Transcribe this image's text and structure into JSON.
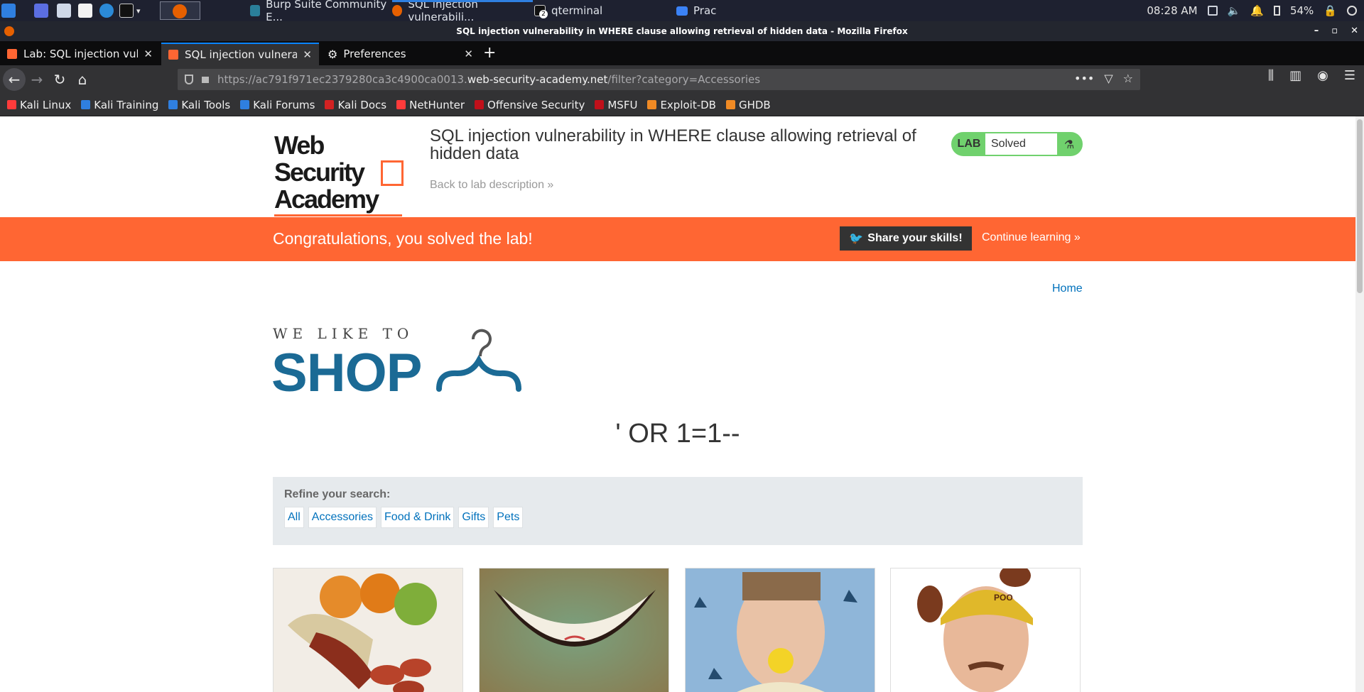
{
  "taskbar": {
    "windows": [
      {
        "label": "Burp Suite Community E..."
      },
      {
        "label": "SQL injection vulnerabili..."
      },
      {
        "label": "qterminal"
      },
      {
        "label": "Prac"
      }
    ],
    "badge": "2",
    "time": "08:28 AM",
    "battery": "54%"
  },
  "window": {
    "title": "SQL injection vulnerability in WHERE clause allowing retrieval of hidden data - Mozilla Firefox"
  },
  "tabs": [
    {
      "label": "Lab: SQL injection vulnera"
    },
    {
      "label": "SQL injection vulnerabilit"
    },
    {
      "label": "Preferences"
    }
  ],
  "urlbar": {
    "prefix": "https://ac791f971ec2379280ca3c4900ca0013.",
    "host": "web-security-academy.net",
    "path": "/filter?category=Accessories"
  },
  "bookmarks": [
    {
      "label": "Kali Linux",
      "color": "#ff3b3b"
    },
    {
      "label": "Kali Training",
      "color": "#2f7fe0"
    },
    {
      "label": "Kali Tools",
      "color": "#2f7fe0"
    },
    {
      "label": "Kali Forums",
      "color": "#2f7fe0"
    },
    {
      "label": "Kali Docs",
      "color": "#d22222"
    },
    {
      "label": "NetHunter",
      "color": "#ff3b3b"
    },
    {
      "label": "Offensive Security",
      "color": "#c0101a"
    },
    {
      "label": "MSFU",
      "color": "#c0101a"
    },
    {
      "label": "Exploit-DB",
      "color": "#f08a24"
    },
    {
      "label": "GHDB",
      "color": "#f08a24"
    }
  ],
  "header": {
    "logo_line1": "Web Security",
    "logo_line2": "Academy",
    "lab_title": "SQL injection vulnerability in WHERE clause allowing retrieval of hidden data",
    "back_link": "Back to lab description »",
    "status_tag": "LAB",
    "status_value": "Solved"
  },
  "banner": {
    "message": "Congratulations, you solved the lab!",
    "share_label": "Share your skills!",
    "continue_label": "Continue learning »",
    "color": "#ff6633"
  },
  "nav": {
    "home": "Home"
  },
  "hero": {
    "small": "WE LIKE TO",
    "big": "SHOP"
  },
  "search_term": "' OR 1=1--",
  "refine": {
    "label": "Refine your search:",
    "filters": [
      "All",
      "Accessories",
      "Food & Drink",
      "Gifts",
      "Pets"
    ]
  },
  "colors": {
    "accent": "#ff6633",
    "link": "#0071bc",
    "status_green": "#70d16d",
    "shop_blue": "#1b6a95"
  }
}
